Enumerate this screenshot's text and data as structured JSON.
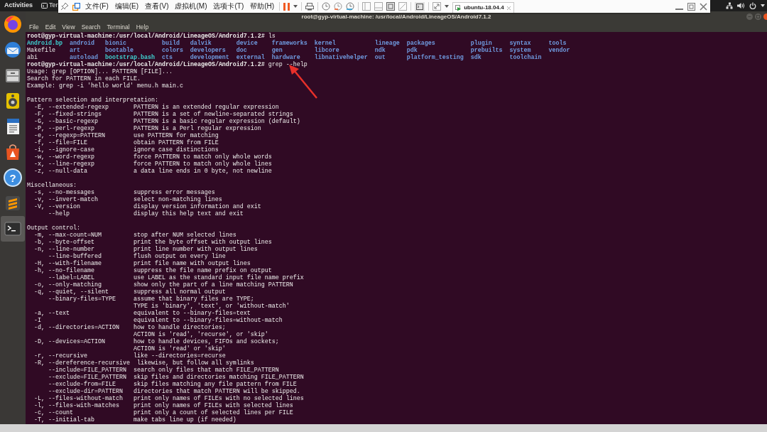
{
  "top_bar": {
    "activities": "Activities",
    "app": "Ter"
  },
  "vm_toolbar": {
    "menus": [
      "文件(F)",
      "编辑(E)",
      "查看(V)",
      "虚拟机(M)",
      "选项卡(T)",
      "帮助(H)"
    ],
    "tab": "ubuntu-18.04.4"
  },
  "dock": [
    {
      "kind": "firefox",
      "selected": false
    },
    {
      "kind": "mail",
      "selected": false
    },
    {
      "kind": "files",
      "selected": false
    },
    {
      "kind": "music",
      "selected": false
    },
    {
      "kind": "writer",
      "selected": false
    },
    {
      "kind": "software",
      "selected": false
    },
    {
      "kind": "help",
      "label": "?",
      "selected": false
    },
    {
      "kind": "editor",
      "selected": false
    },
    {
      "kind": "terminal",
      "selected": true
    }
  ],
  "terminal": {
    "title": "root@gyp-virtual-machine: /usr/local/Android/LineageOS/Android7.1.2",
    "menus": [
      "File",
      "Edit",
      "View",
      "Search",
      "Terminal",
      "Help"
    ],
    "lines": [
      {
        "kind": "prompt",
        "prompt": "root@gyp-virtual-machine:/usr/local/Android/LineageOS/Android7.1.2#",
        "command": "ls"
      },
      {
        "kind": "listing",
        "rows": [
          [
            {
              "name": "Android.bp",
              "kind": "link"
            },
            {
              "name": "android",
              "kind": "dir"
            },
            {
              "name": "bionic",
              "kind": "dir"
            },
            {
              "name": "build",
              "kind": "dir"
            },
            {
              "name": "dalvik",
              "kind": "dir"
            },
            {
              "name": "device",
              "kind": "dir"
            },
            {
              "name": "frameworks",
              "kind": "dir"
            },
            {
              "name": "kernel",
              "kind": "dir"
            },
            {
              "name": "lineage",
              "kind": "dir"
            },
            {
              "name": "packages",
              "kind": "dir"
            },
            {
              "name": "plugin",
              "kind": "dir"
            },
            {
              "name": "syntax",
              "kind": "dir"
            },
            {
              "name": "tools",
              "kind": "dir"
            }
          ],
          [
            {
              "name": "Makefile",
              "kind": "file"
            },
            {
              "name": "art",
              "kind": "dir"
            },
            {
              "name": "bootable",
              "kind": "dir"
            },
            {
              "name": "colors",
              "kind": "dir"
            },
            {
              "name": "developers",
              "kind": "dir"
            },
            {
              "name": "doc",
              "kind": "dir"
            },
            {
              "name": "gen",
              "kind": "dir"
            },
            {
              "name": "libcore",
              "kind": "dir"
            },
            {
              "name": "ndk",
              "kind": "dir"
            },
            {
              "name": "pdk",
              "kind": "dir"
            },
            {
              "name": "prebuilts",
              "kind": "dir"
            },
            {
              "name": "system",
              "kind": "dir"
            },
            {
              "name": "vendor",
              "kind": "dir"
            }
          ],
          [
            {
              "name": "abi",
              "kind": "file"
            },
            {
              "name": "autoload",
              "kind": "dir"
            },
            {
              "name": "bootstrap.bash",
              "kind": "link"
            },
            {
              "name": "cts",
              "kind": "dir"
            },
            {
              "name": "development",
              "kind": "dir"
            },
            {
              "name": "external",
              "kind": "dir"
            },
            {
              "name": "hardware",
              "kind": "dir"
            },
            {
              "name": "libnativehelper",
              "kind": "dir"
            },
            {
              "name": "out",
              "kind": "dir"
            },
            {
              "name": "platform_testing",
              "kind": "dir"
            },
            {
              "name": "sdk",
              "kind": "dir"
            },
            {
              "name": "toolchain",
              "kind": "dir"
            }
          ]
        ]
      },
      {
        "kind": "prompt",
        "prompt": "root@gyp-virtual-machine:/usr/local/Android/LineageOS/Android7.1.2#",
        "command": "grep --help"
      },
      {
        "kind": "text",
        "text": "Usage: grep [OPTION]... PATTERN [FILE]..."
      },
      {
        "kind": "text",
        "text": "Search for PATTERN in each FILE."
      },
      {
        "kind": "text",
        "text": "Example: grep -i 'hello world' menu.h main.c"
      },
      {
        "kind": "blank"
      },
      {
        "kind": "text",
        "text": "Pattern selection and interpretation:"
      },
      {
        "kind": "option",
        "option": "-E, --extended-regexp",
        "description": "PATTERN is an extended regular expression",
        "indented": false
      },
      {
        "kind": "option",
        "option": "-F, --fixed-strings",
        "description": "PATTERN is a set of newline-separated strings",
        "indented": false
      },
      {
        "kind": "option",
        "option": "-G, --basic-regexp",
        "description": "PATTERN is a basic regular expression (default)",
        "indented": false
      },
      {
        "kind": "option",
        "option": "-P, --perl-regexp",
        "description": "PATTERN is a Perl regular expression",
        "indented": false
      },
      {
        "kind": "option",
        "option": "-e, --regexp=PATTERN",
        "description": "use PATTERN for matching",
        "indented": false
      },
      {
        "kind": "option",
        "option": "-f, --file=FILE",
        "description": "obtain PATTERN from FILE",
        "indented": false
      },
      {
        "kind": "option",
        "option": "-i, --ignore-case",
        "description": "ignore case distinctions",
        "indented": false
      },
      {
        "kind": "option",
        "option": "-w, --word-regexp",
        "description": "force PATTERN to match only whole words",
        "indented": false
      },
      {
        "kind": "option",
        "option": "-x, --line-regexp",
        "description": "force PATTERN to match only whole lines",
        "indented": false
      },
      {
        "kind": "option",
        "option": "-z, --null-data",
        "description": "a data line ends in 0 byte, not newline",
        "indented": false
      },
      {
        "kind": "blank"
      },
      {
        "kind": "text",
        "text": "Miscellaneous:"
      },
      {
        "kind": "option",
        "option": "-s, --no-messages",
        "description": "suppress error messages",
        "indented": false
      },
      {
        "kind": "option",
        "option": "-v, --invert-match",
        "description": "select non-matching lines",
        "indented": false
      },
      {
        "kind": "option",
        "option": "-V, --version",
        "description": "display version information and exit",
        "indented": false
      },
      {
        "kind": "option",
        "option": "--help",
        "description": "display this help text and exit",
        "indented": true
      },
      {
        "kind": "blank"
      },
      {
        "kind": "text",
        "text": "Output control:"
      },
      {
        "kind": "option",
        "option": "-m, --max-count=NUM",
        "description": "stop after NUM selected lines",
        "indented": false
      },
      {
        "kind": "option",
        "option": "-b, --byte-offset",
        "description": "print the byte offset with output lines",
        "indented": false
      },
      {
        "kind": "option",
        "option": "-n, --line-number",
        "description": "print line number with output lines",
        "indented": false
      },
      {
        "kind": "option",
        "option": "--line-buffered",
        "description": "flush output on every line",
        "indented": true
      },
      {
        "kind": "option",
        "option": "-H, --with-filename",
        "description": "print file name with output lines",
        "indented": false
      },
      {
        "kind": "option",
        "option": "-h, --no-filename",
        "description": "suppress the file name prefix on output",
        "indented": false
      },
      {
        "kind": "option",
        "option": "--label=LABEL",
        "description": "use LABEL as the standard input file name prefix",
        "indented": true
      },
      {
        "kind": "option",
        "option": "-o, --only-matching",
        "description": "show only the part of a line matching PATTERN",
        "indented": false
      },
      {
        "kind": "option",
        "option": "-q, --quiet, --silent",
        "description": "suppress all normal output",
        "indented": false
      },
      {
        "kind": "option",
        "option": "--binary-files=TYPE",
        "description": "assume that binary files are TYPE;",
        "indented": true
      },
      {
        "kind": "continuation",
        "description": "TYPE is 'binary', 'text', or 'without-match'"
      },
      {
        "kind": "option",
        "option": "-a, --text",
        "description": "equivalent to --binary-files=text",
        "indented": false
      },
      {
        "kind": "option",
        "option": "-I",
        "description": "equivalent to --binary-files=without-match",
        "indented": false
      },
      {
        "kind": "option",
        "option": "-d, --directories=ACTION",
        "description": "how to handle directories;",
        "indented": false
      },
      {
        "kind": "continuation",
        "description": "ACTION is 'read', 'recurse', or 'skip'"
      },
      {
        "kind": "option",
        "option": "-D, --devices=ACTION",
        "description": "how to handle devices, FIFOs and sockets;",
        "indented": false
      },
      {
        "kind": "continuation",
        "description": "ACTION is 'read' or 'skip'"
      },
      {
        "kind": "option",
        "option": "-r, --recursive",
        "description": "like --directories=recurse",
        "indented": false
      },
      {
        "kind": "option",
        "option": "-R, --dereference-recursive",
        "description": "likewise, but follow all symlinks",
        "indented": false
      },
      {
        "kind": "option",
        "option": "--include=FILE_PATTERN",
        "description": "search only files that match FILE_PATTERN",
        "indented": true
      },
      {
        "kind": "option",
        "option": "--exclude=FILE_PATTERN",
        "description": "skip files and directories matching FILE_PATTERN",
        "indented": true
      },
      {
        "kind": "option",
        "option": "--exclude-from=FILE",
        "description": "skip files matching any file pattern from FILE",
        "indented": true
      },
      {
        "kind": "option",
        "option": "--exclude-dir=PATTERN",
        "description": "directories that match PATTERN will be skipped.",
        "indented": true
      },
      {
        "kind": "option",
        "option": "-L, --files-without-match",
        "description": "print only names of FILEs with no selected lines",
        "indented": false
      },
      {
        "kind": "option",
        "option": "-l, --files-with-matches",
        "description": "print only names of FILEs with selected lines",
        "indented": false
      },
      {
        "kind": "option",
        "option": "-c, --count",
        "description": "print only a count of selected lines per FILE",
        "indented": false
      },
      {
        "kind": "option",
        "option": "-T, --initial-tab",
        "description": "make tabs line up (if needed)",
        "indented": false
      }
    ]
  }
}
